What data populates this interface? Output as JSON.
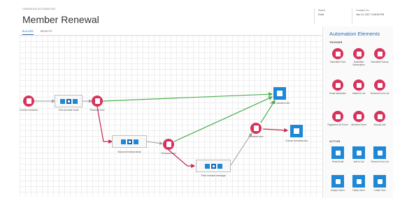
{
  "header": {
    "breadcrumb": "CAMPAIGN AUTOMATION",
    "title": "Member Renewal",
    "tabs": [
      {
        "label": "BUILDER",
        "active": true
      },
      {
        "label": "INSIGHTS",
        "active": false
      }
    ],
    "status": {
      "label": "Status",
      "value": "Draft"
    },
    "created": {
      "label": "Created On",
      "value": "Jan 14, 2017 3:38:50 PM"
    }
  },
  "canvas": {
    "nodes": {
      "current_members": {
        "label": "Current members",
        "icon": "list-icon",
        "color": "#d8325c"
      },
      "first_email": {
        "label": "First renewal email",
        "icon": "email-icon"
      },
      "renewal_form_1": {
        "label": "Renewal form",
        "icon": "form-icon",
        "color": "#d8325c"
      },
      "second_email": {
        "label": "Second renewal email",
        "icon": "email-icon"
      },
      "renewal_form_2": {
        "label": "Renewal form",
        "icon": "form-icon",
        "color": "#d8325c"
      },
      "third_email": {
        "label": "Third renewal message",
        "icon": "email-icon"
      },
      "renewal_form_3": {
        "label": "Renewal form",
        "icon": "form-icon",
        "color": "#d8325c"
      },
      "renewed_list": {
        "label": "2017 members list",
        "icon": "list-add-icon",
        "color": "#1e88d6"
      },
      "former_list": {
        "label": "Former members list",
        "icon": "list-add-icon",
        "color": "#1e88d6"
      }
    },
    "colors": {
      "yes_path": "#4caf50",
      "no_path": "#c62850",
      "default_path": "#9e9e9e"
    }
  },
  "panel": {
    "title": "Automation Elements",
    "triggers_label": "TRIGGER",
    "actions_label": "ACTION",
    "triggers": [
      {
        "label": "Submitted Form",
        "icon": "form-icon"
      },
      {
        "label": "Submitted Subscription",
        "icon": "subscription-icon"
      },
      {
        "label": "Submitted Survey",
        "icon": "survey-icon"
      },
      {
        "label": "Email Interaction",
        "icon": "email-interaction-icon"
      },
      {
        "label": "Added to List",
        "icon": "list-add-icon"
      },
      {
        "label": "Removed from List",
        "icon": "list-remove-icon"
      },
      {
        "label": "Registered for Event",
        "icon": "event-icon"
      },
      {
        "label": "Attended Event",
        "icon": "attended-icon"
      },
      {
        "label": "Manual Add",
        "icon": "manual-add-icon"
      }
    ],
    "actions": [
      {
        "label": "Send Email",
        "icon": "send-email-icon"
      },
      {
        "label": "Add to List",
        "icon": "add-list-icon"
      },
      {
        "label": "Remove from List",
        "icon": "remove-list-icon"
      },
      {
        "label": "Assign Owner",
        "icon": "assign-owner-icon"
      },
      {
        "label": "Notify Users",
        "icon": "notify-icon"
      },
      {
        "label": "Create Task",
        "icon": "task-icon"
      }
    ]
  }
}
